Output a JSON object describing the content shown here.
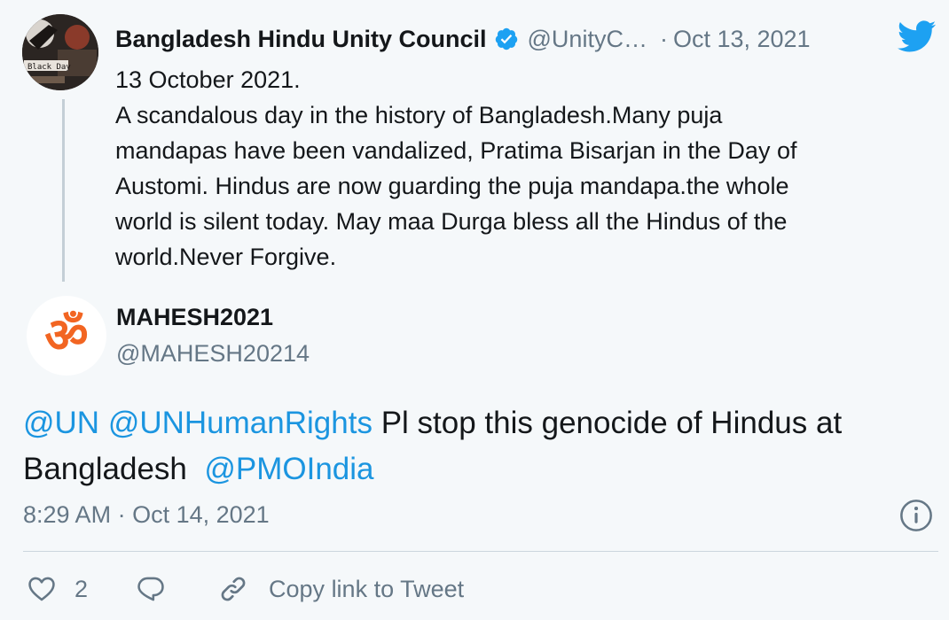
{
  "parent_tweet": {
    "author_name": "Bangladesh Hindu Unity Council",
    "handle": "@UnityC…",
    "separator": "·",
    "date": "Oct 13, 2021",
    "avatar_text": "Black Day",
    "body_lines": [
      "13 October 2021.",
      "A scandalous day in the history of Bangladesh.Many puja",
      "mandapas have been vandalized, Pratima Bisarjan in the Day of",
      "Austomi. Hindus are now guarding the puja mandapa.the whole",
      "world is silent today. May maa Durga bless all the Hindus of the",
      "world.Never Forgive."
    ]
  },
  "reply_tweet": {
    "author_name": "MAHESH2021",
    "handle": "@MAHESH20214",
    "avatar_symbol": "ॐ",
    "text_segments": {
      "mention_1": "@UN",
      "mention_2": "@UNHumanRights",
      "text_1": "Pl stop this genocide of Hindus at",
      "text_2": "Bangladesh",
      "mention_3": "@PMOIndia"
    },
    "time": "8:29 AM",
    "separator": "·",
    "date": "Oct 14, 2021"
  },
  "actions": {
    "like_count": "2",
    "copy_link_label": "Copy link to Tweet"
  },
  "colors": {
    "background": "#f5f8fa",
    "link_blue": "#1b95e0",
    "twitter_blue": "#1da1f2",
    "muted": "#657786",
    "om_orange": "#f26522"
  }
}
